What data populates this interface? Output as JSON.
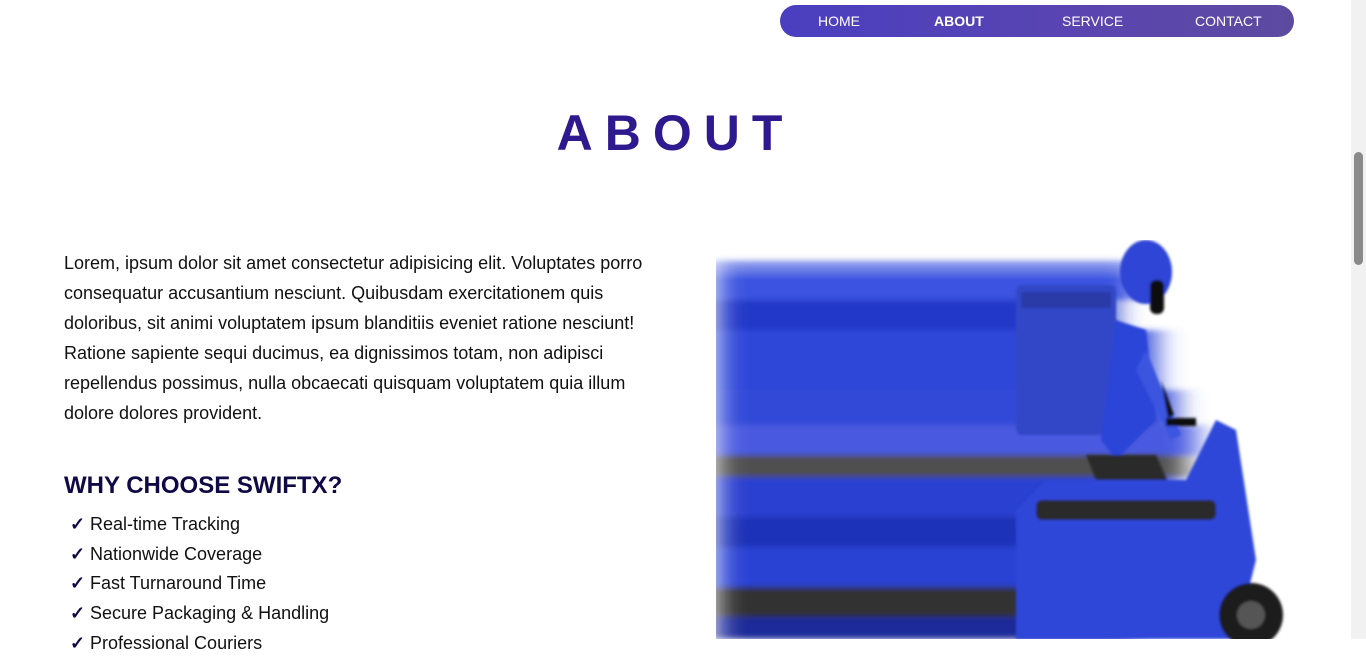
{
  "nav": {
    "items": [
      {
        "label": "HOME",
        "active": false
      },
      {
        "label": "ABOUT",
        "active": true
      },
      {
        "label": "SERVICE",
        "active": false
      },
      {
        "label": "CONTACT",
        "active": false
      }
    ]
  },
  "about": {
    "title": "ABOUT",
    "paragraph": "Lorem, ipsum dolor sit amet consectetur adipisicing elit. Voluptates porro consequatur accusantium nesciunt. Quibusdam exercitationem quis doloribus, sit animi voluptatem ipsum blanditiis eveniet ratione nesciunt! Ratione sapiente sequi ducimus, ea dignissimos totam, non adipisci repellendus possimus, nulla obcaecati quisquam voluptatem quia illum dolore dolores provident.",
    "why_heading": "WHY CHOOSE SWIFTX?",
    "check_symbol": "✓",
    "features": [
      "Real-time Tracking",
      "Nationwide Coverage",
      "Fast Turnaround Time",
      "Secure Packaging & Handling",
      "Professional Couriers"
    ]
  },
  "colors": {
    "nav_gradient_start": "#4a3fc0",
    "nav_gradient_end": "#5d4aa0",
    "title": "#2e1a8e",
    "heading": "#0f0a45",
    "scooter_blue": "#2f46d9"
  },
  "hero_image": {
    "icon": "delivery-scooter-rider-image"
  }
}
